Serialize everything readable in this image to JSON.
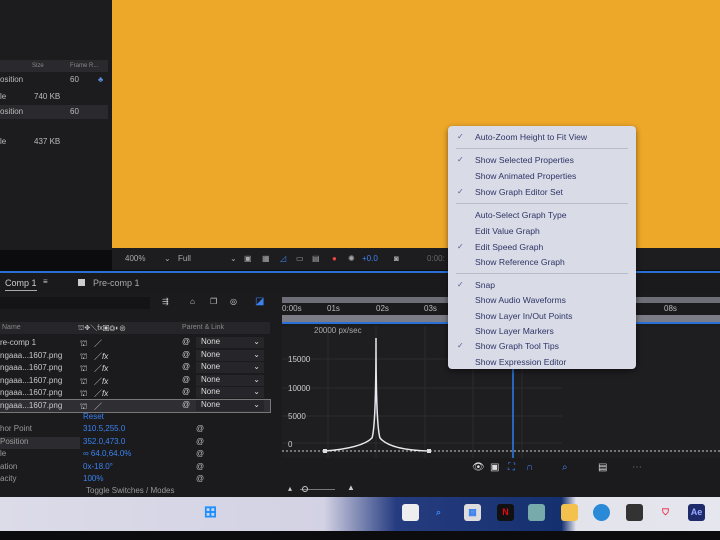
{
  "project": {
    "headers": {
      "size": "Size",
      "frame_rate": "Frame R..."
    },
    "rows": [
      {
        "name": "osition",
        "size": "",
        "fps": "60"
      },
      {
        "name": "le",
        "size": "740 KB",
        "fps": ""
      },
      {
        "name": "osition",
        "size": "",
        "fps": "60"
      },
      {
        "name": "le",
        "size": "437 KB",
        "fps": ""
      }
    ]
  },
  "viewer": {
    "bg_color": "#eea829",
    "zoom": "400%",
    "resolution": "Full",
    "exposure": "+0.0",
    "timecode": "0:00:"
  },
  "tabs": [
    {
      "label": "Comp 1"
    },
    {
      "label": "Pre-comp 1"
    }
  ],
  "timeline": {
    "name_header": "Name",
    "parent_header": "Parent & Link",
    "ruler": [
      "0:00s",
      "01s",
      "02s",
      "03s",
      "08s"
    ],
    "layers": [
      {
        "name": "re-comp 1",
        "fx": "",
        "parent": "None"
      },
      {
        "name": "ngaaa...1607.png",
        "fx": "fx",
        "parent": "None"
      },
      {
        "name": "ngaaa...1607.png",
        "fx": "fx",
        "parent": "None"
      },
      {
        "name": "ngaaa...1607.png",
        "fx": "fx",
        "parent": "None"
      },
      {
        "name": "ngaaa...1607.png",
        "fx": "fx",
        "parent": "None"
      },
      {
        "name": "ngaaa...1607.png",
        "fx": "",
        "parent": "None"
      }
    ],
    "reset": "Reset",
    "properties": [
      {
        "name": "hor Point",
        "value": "310.5,255.0"
      },
      {
        "name": "Position",
        "value": "352.0,473.0"
      },
      {
        "name": "le",
        "value": "∞ 64.0,64.0%"
      },
      {
        "name": "ation",
        "value": "0x-18.0°"
      },
      {
        "name": "acity",
        "value": "100%"
      }
    ],
    "toggle": "Toggle Switches / Modes"
  },
  "graph": {
    "unit_label": "20000 px/sec",
    "y_ticks": [
      "15000",
      "10000",
      "5000",
      "0"
    ]
  },
  "menu": {
    "items": [
      {
        "label": "Auto-Zoom Height to Fit View",
        "checked": true
      },
      {
        "label": "Show Selected Properties",
        "checked": true
      },
      {
        "label": "Show Animated Properties",
        "checked": false
      },
      {
        "label": "Show Graph Editor Set",
        "checked": true
      },
      {
        "label": "Auto-Select Graph Type",
        "checked": false
      },
      {
        "label": "Edit Value Graph",
        "checked": false
      },
      {
        "label": "Edit Speed Graph",
        "checked": true
      },
      {
        "label": "Show Reference Graph",
        "checked": false
      },
      {
        "label": "Snap",
        "checked": true
      },
      {
        "label": "Show Audio Waveforms",
        "checked": false
      },
      {
        "label": "Show Layer In/Out Points",
        "checked": false
      },
      {
        "label": "Show Layer Markers",
        "checked": false
      },
      {
        "label": "Show Graph Tool Tips",
        "checked": true
      },
      {
        "label": "Show Expression Editor",
        "checked": false
      }
    ],
    "check": "✓"
  },
  "taskbar": {
    "ae_label": "Ae",
    "netflix_label": "N"
  }
}
